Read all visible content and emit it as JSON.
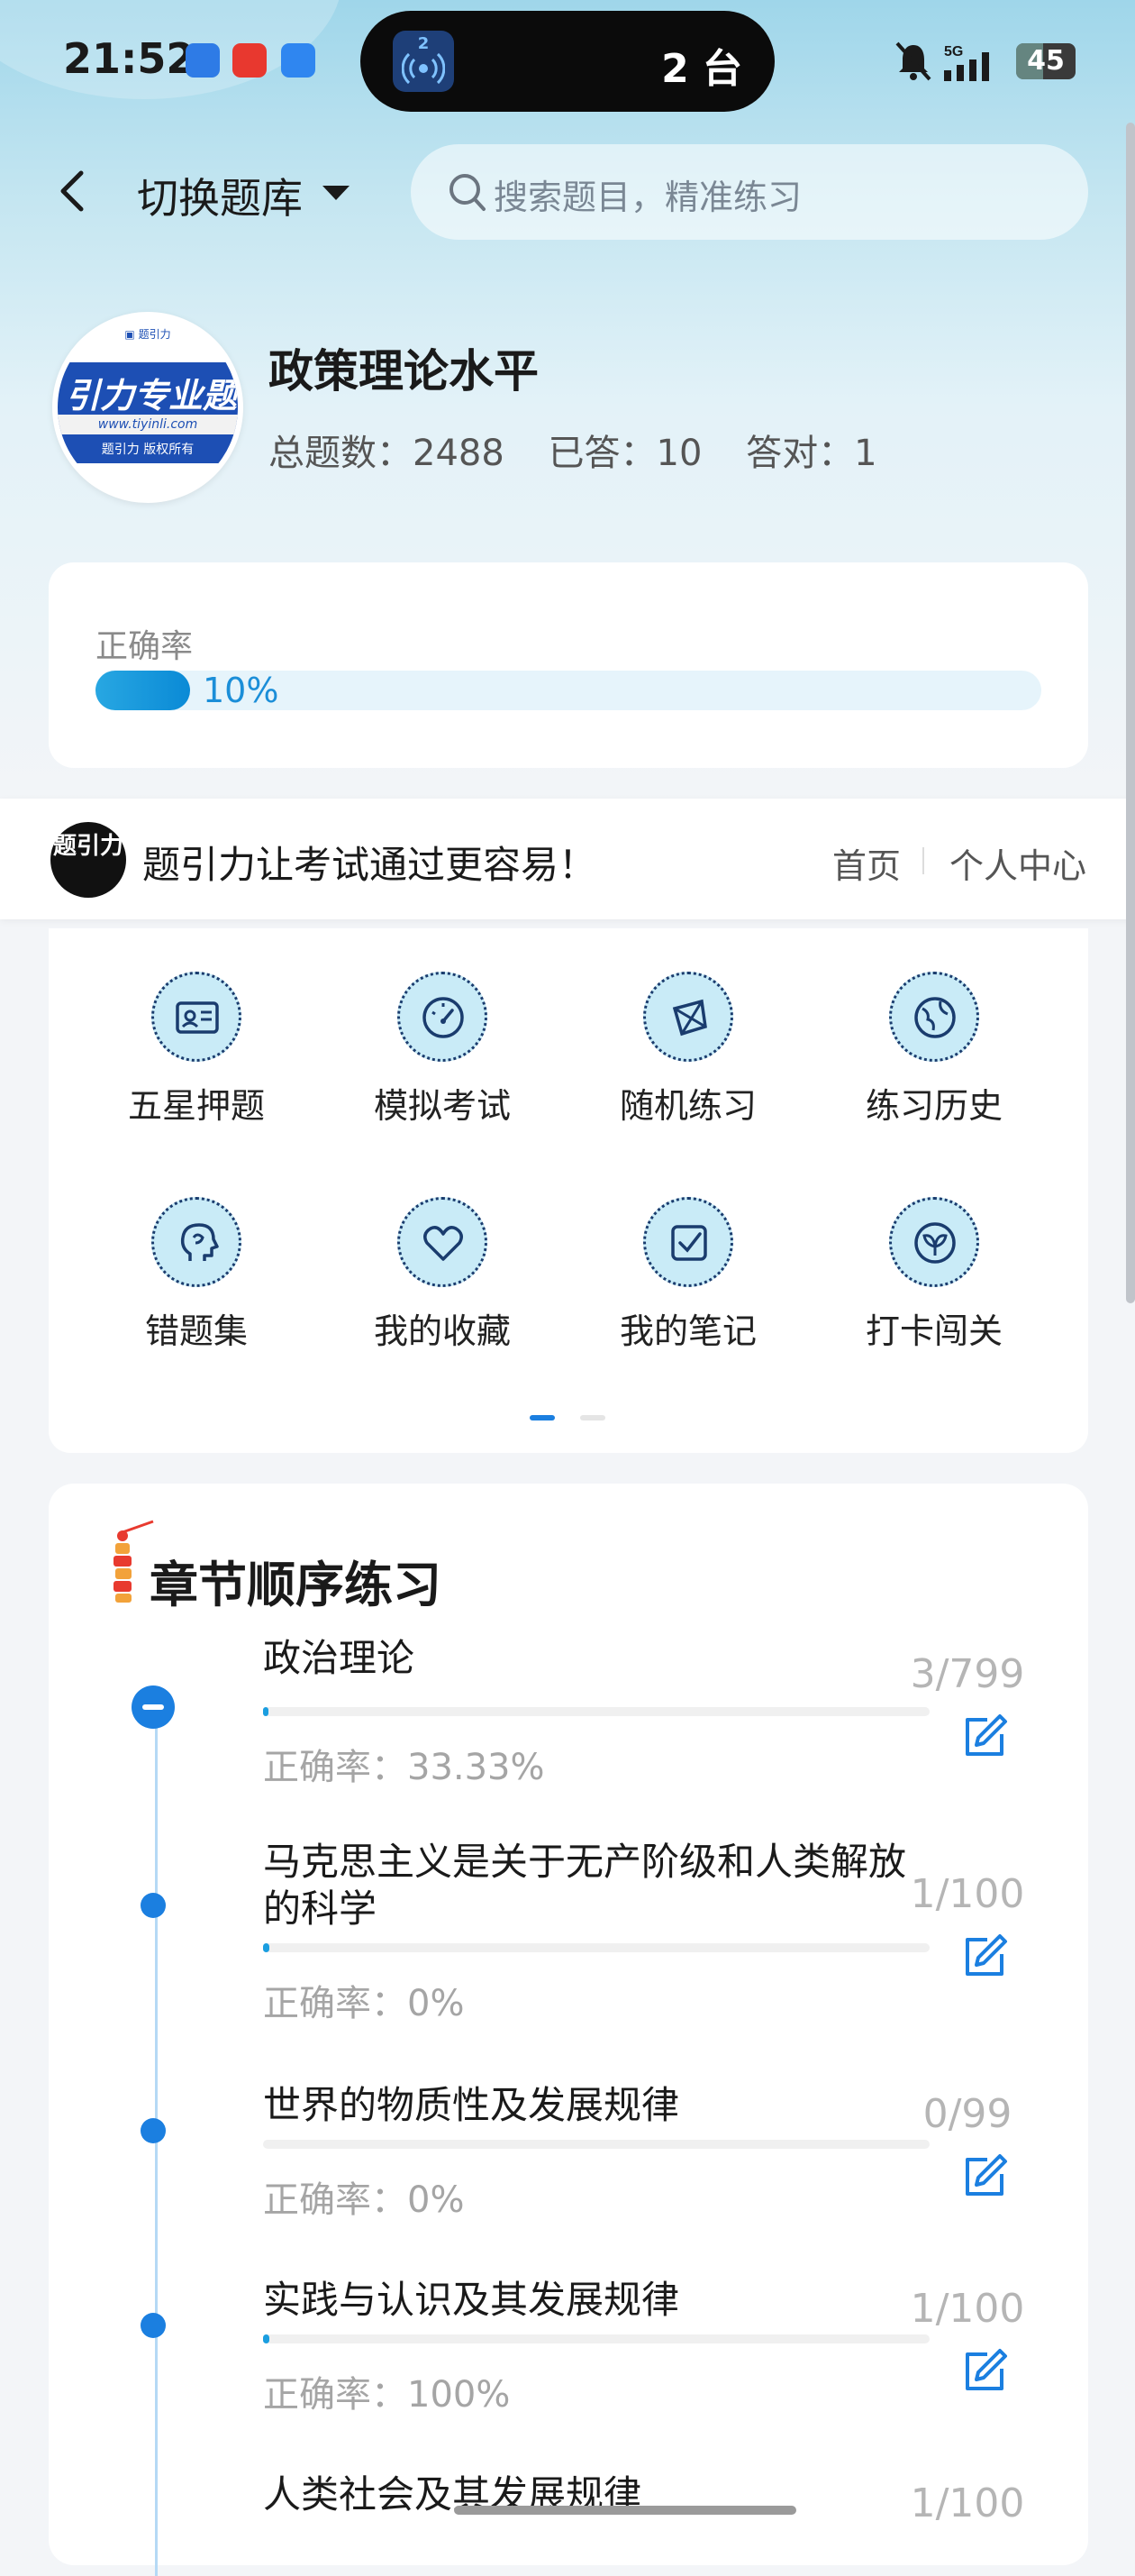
{
  "status_bar": {
    "time": "21:52",
    "pill_badge": "2",
    "pill_text": "2 台",
    "battery": "45",
    "network": "5G"
  },
  "header": {
    "switch_label": "切换题库",
    "search_placeholder": "搜索题目，精准练习"
  },
  "bank": {
    "logo_main": "引力专业题",
    "logo_url": "www.tiyinli.com",
    "logo_copyright": "题引力 版权所有",
    "title": "政策理论水平",
    "total": "总题数：2488",
    "answered": "已答：10",
    "correct": "答对：1"
  },
  "accuracy": {
    "label": "正确率",
    "percent_text": "10%",
    "fraction": 0.1
  },
  "banner": {
    "logo_text": "题引力",
    "slogan": "题引力让考试通过更容易！",
    "home": "首页",
    "profile": "个人中心"
  },
  "features": [
    {
      "label": "五星押题",
      "icon": "id-card-icon"
    },
    {
      "label": "模拟考试",
      "icon": "speedometer-icon"
    },
    {
      "label": "随机练习",
      "icon": "network-icon"
    },
    {
      "label": "练习历史",
      "icon": "globe-icon"
    },
    {
      "label": "错题集",
      "icon": "head-icon"
    },
    {
      "label": "我的收藏",
      "icon": "heart-icon"
    },
    {
      "label": "我的笔记",
      "icon": "checkbox-icon"
    },
    {
      "label": "打卡闯关",
      "icon": "leaf-icon"
    }
  ],
  "chapters": {
    "title": "章节顺序练习",
    "items": [
      {
        "name": "政治理论",
        "accuracy": "正确率：33.33%",
        "count": "3/799",
        "progress": 0.004
      },
      {
        "name": "马克思主义是关于无产阶级和人类解放的科学",
        "accuracy": "正确率：0%",
        "count": "1/100",
        "progress": 0.01
      },
      {
        "name": "世界的物质性及发展规律",
        "accuracy": "正确率：0%",
        "count": "0/99",
        "progress": 0
      },
      {
        "name": "实践与认识及其发展规律",
        "accuracy": "正确率：100%",
        "count": "1/100",
        "progress": 0.01
      },
      {
        "name": "人类社会及其发展规律",
        "accuracy": "",
        "count": "1/100",
        "progress": 0.01
      }
    ]
  },
  "colors": {
    "accent": "#1b7fe0",
    "icon_bg": "#c9ebf7"
  }
}
